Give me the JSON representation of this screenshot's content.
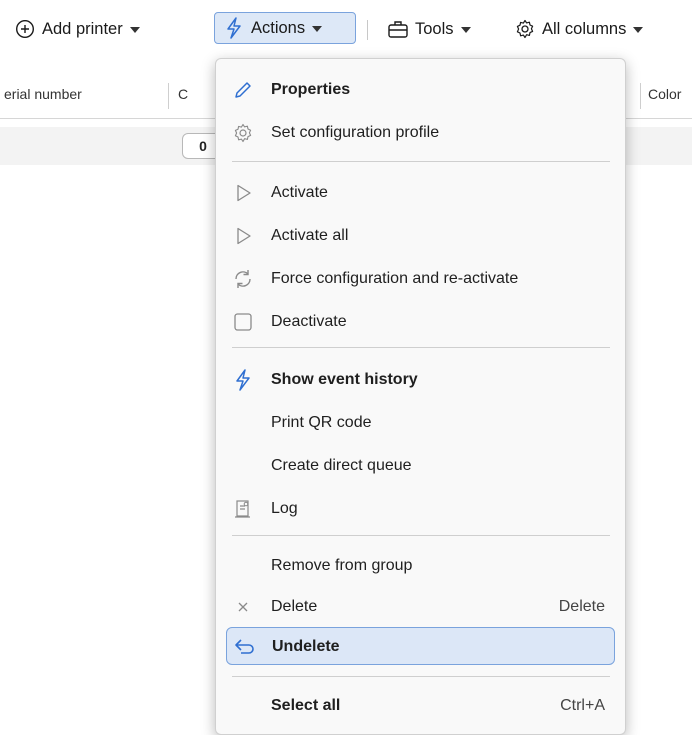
{
  "toolbar": {
    "add_printer": "Add printer",
    "actions": "Actions",
    "tools": "Tools",
    "all_columns": "All columns",
    "accent_color": "#2f6fd1"
  },
  "columns": {
    "serial_number": "erial number",
    "col_c": "C",
    "color": "Color"
  },
  "count_value": "0",
  "menu": {
    "items": [
      {
        "label": "Properties",
        "shortcut": "",
        "icon": "pencil-icon"
      },
      {
        "label": "Set configuration profile",
        "shortcut": "",
        "icon": "gear-icon"
      },
      {
        "label": "Activate",
        "shortcut": "",
        "icon": "play-outline-icon"
      },
      {
        "label": "Activate all",
        "shortcut": "",
        "icon": "play-outline-icon"
      },
      {
        "label": "Force configuration and re-activate",
        "shortcut": "",
        "icon": "refresh-icon"
      },
      {
        "label": "Deactivate",
        "shortcut": "",
        "icon": "square-icon"
      },
      {
        "label": "Show event history",
        "shortcut": "",
        "icon": "lightning-icon"
      },
      {
        "label": "Print QR code",
        "shortcut": "",
        "icon": ""
      },
      {
        "label": "Create direct queue",
        "shortcut": "",
        "icon": ""
      },
      {
        "label": "Log",
        "shortcut": "",
        "icon": "log-icon"
      },
      {
        "label": "Remove from group",
        "shortcut": "",
        "icon": ""
      },
      {
        "label": "Delete",
        "shortcut": "Delete",
        "icon": "x-icon"
      },
      {
        "label": "Undelete",
        "shortcut": "",
        "icon": "undo-icon"
      },
      {
        "label": "Select all",
        "shortcut": "Ctrl+A",
        "icon": ""
      }
    ]
  }
}
